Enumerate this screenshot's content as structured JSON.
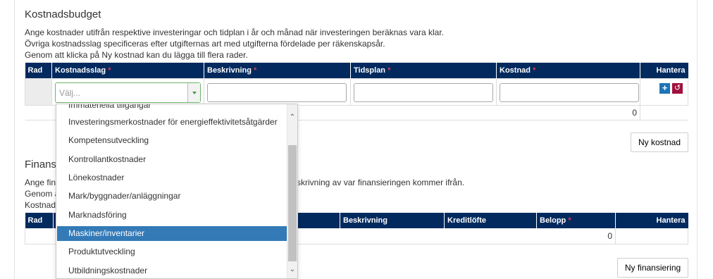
{
  "budget": {
    "title": "Kostnadsbudget",
    "intro_lines": [
      "Ange kostnader utifrån respektive investeringar och tidplan i år och månad när investeringen beräknas vara klar.",
      "Övriga kostnadsslag specificeras efter utgifternas art med utgifterna fördelade per räkenskapsår.",
      "Genom att klicka på Ny kostnad kan du lägga till flera rader."
    ],
    "columns": {
      "rad": "Rad",
      "kostnadsslag": "Kostnadsslag",
      "beskrivning": "Beskrivning",
      "tidsplan": "Tidsplan",
      "kostnad": "Kostnad",
      "hantera": "Hantera"
    },
    "required_mark": "*",
    "select_placeholder": "Välj...",
    "total": "0",
    "new_button": "Ny kostnad",
    "add_icon_glyph": "+",
    "undo_icon_glyph": "↺"
  },
  "financing": {
    "title_partial": "Finans",
    "intro_partial": [
      "Ange fina",
      "Genom a",
      "Kostnads"
    ],
    "intro_tail": "skrivning av var finansieringen kommer ifrån.",
    "columns": {
      "rad": "Rad",
      "beskrivning": "Beskrivning",
      "kreditlofte": "Kreditlöfte",
      "belopp": "Belopp",
      "hantera": "Hantera"
    },
    "total": "0",
    "new_button": "Ny finansiering"
  },
  "dropdown": {
    "options": [
      "Immateriella tillgångar",
      "Investeringsmerkostnader för energieffektivitetsåtgärder",
      "Kompetensutveckling",
      "Kontrollantkostnader",
      "Lönekostnader",
      "Mark/byggnader/anläggningar",
      "Marknadsföring",
      "Maskiner/inventarier",
      "Produktutveckling",
      "Utbildningskostnader"
    ],
    "highlighted": "Maskiner/inventarier"
  },
  "colors": {
    "header_bg": "#022a5e",
    "required": "#e0384f",
    "highlight": "#337ab7",
    "add_button": "#1d74b7",
    "undo_button": "#a0113d"
  }
}
